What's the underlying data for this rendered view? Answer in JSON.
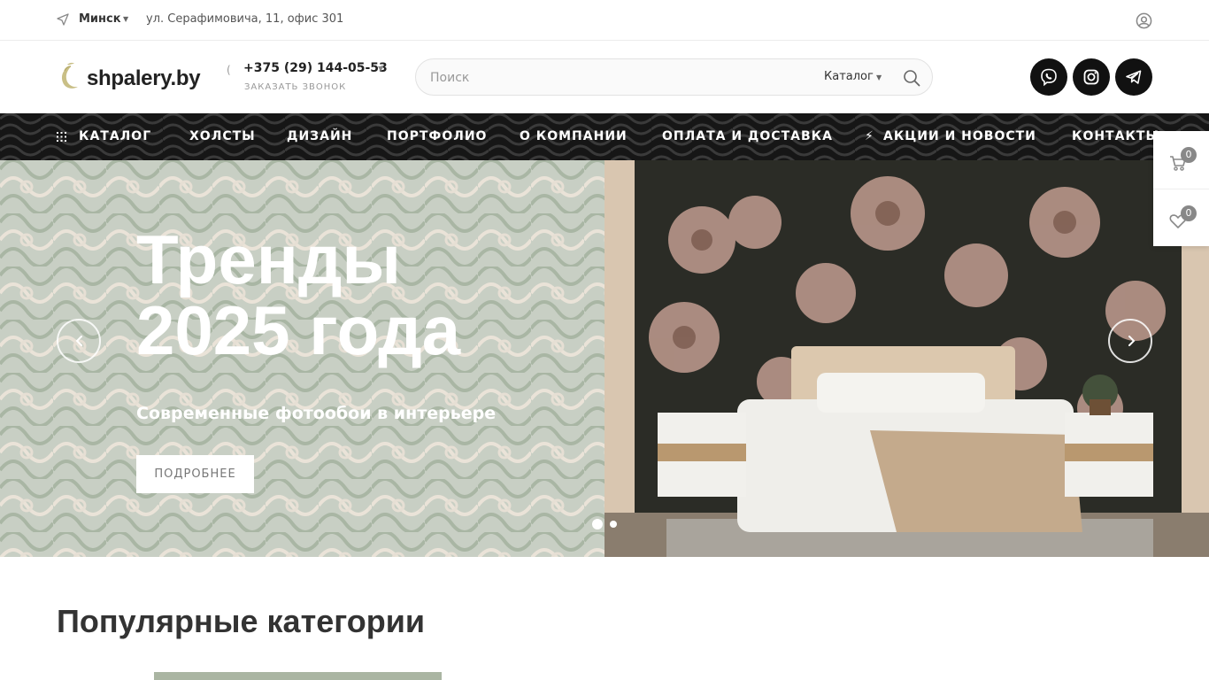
{
  "topbar": {
    "city": "Минск",
    "address": "ул. Серафимовича, 11, офис 301"
  },
  "header": {
    "logo_text": "shpalery.by",
    "phone": "+375 (29) 144-05-53",
    "callback_label": "ЗАКАЗАТЬ ЗВОНОК",
    "search_placeholder": "Поиск",
    "search_scope": "Каталог",
    "social": [
      "viber-icon",
      "instagram-icon",
      "telegram-icon"
    ]
  },
  "nav": {
    "items": [
      "КАТАЛОГ",
      "ХОЛСТЫ",
      "ДИЗАЙН",
      "ПОРТФОЛИО",
      "О КОМПАНИИ",
      "ОПЛАТА И ДОСТАВКА",
      "АКЦИИ И НОВОСТИ",
      "КОНТАКТЫ"
    ]
  },
  "hero": {
    "title_line1": "Тренды",
    "title_line2": "2025 года",
    "subtitle": "Современные фотообои в интерьере",
    "button_label": "ПОДРОБНЕЕ",
    "slides": 2,
    "active_slide": 1
  },
  "side": {
    "cart_count": "0",
    "favorites_count": "0"
  },
  "popular": {
    "title": "Популярные категории"
  },
  "colors": {
    "nav_bg": "#161616",
    "hero_pattern_bg": "#c8cfc4",
    "hero_pattern_line": "#aebaa8",
    "dark": "#111111"
  }
}
